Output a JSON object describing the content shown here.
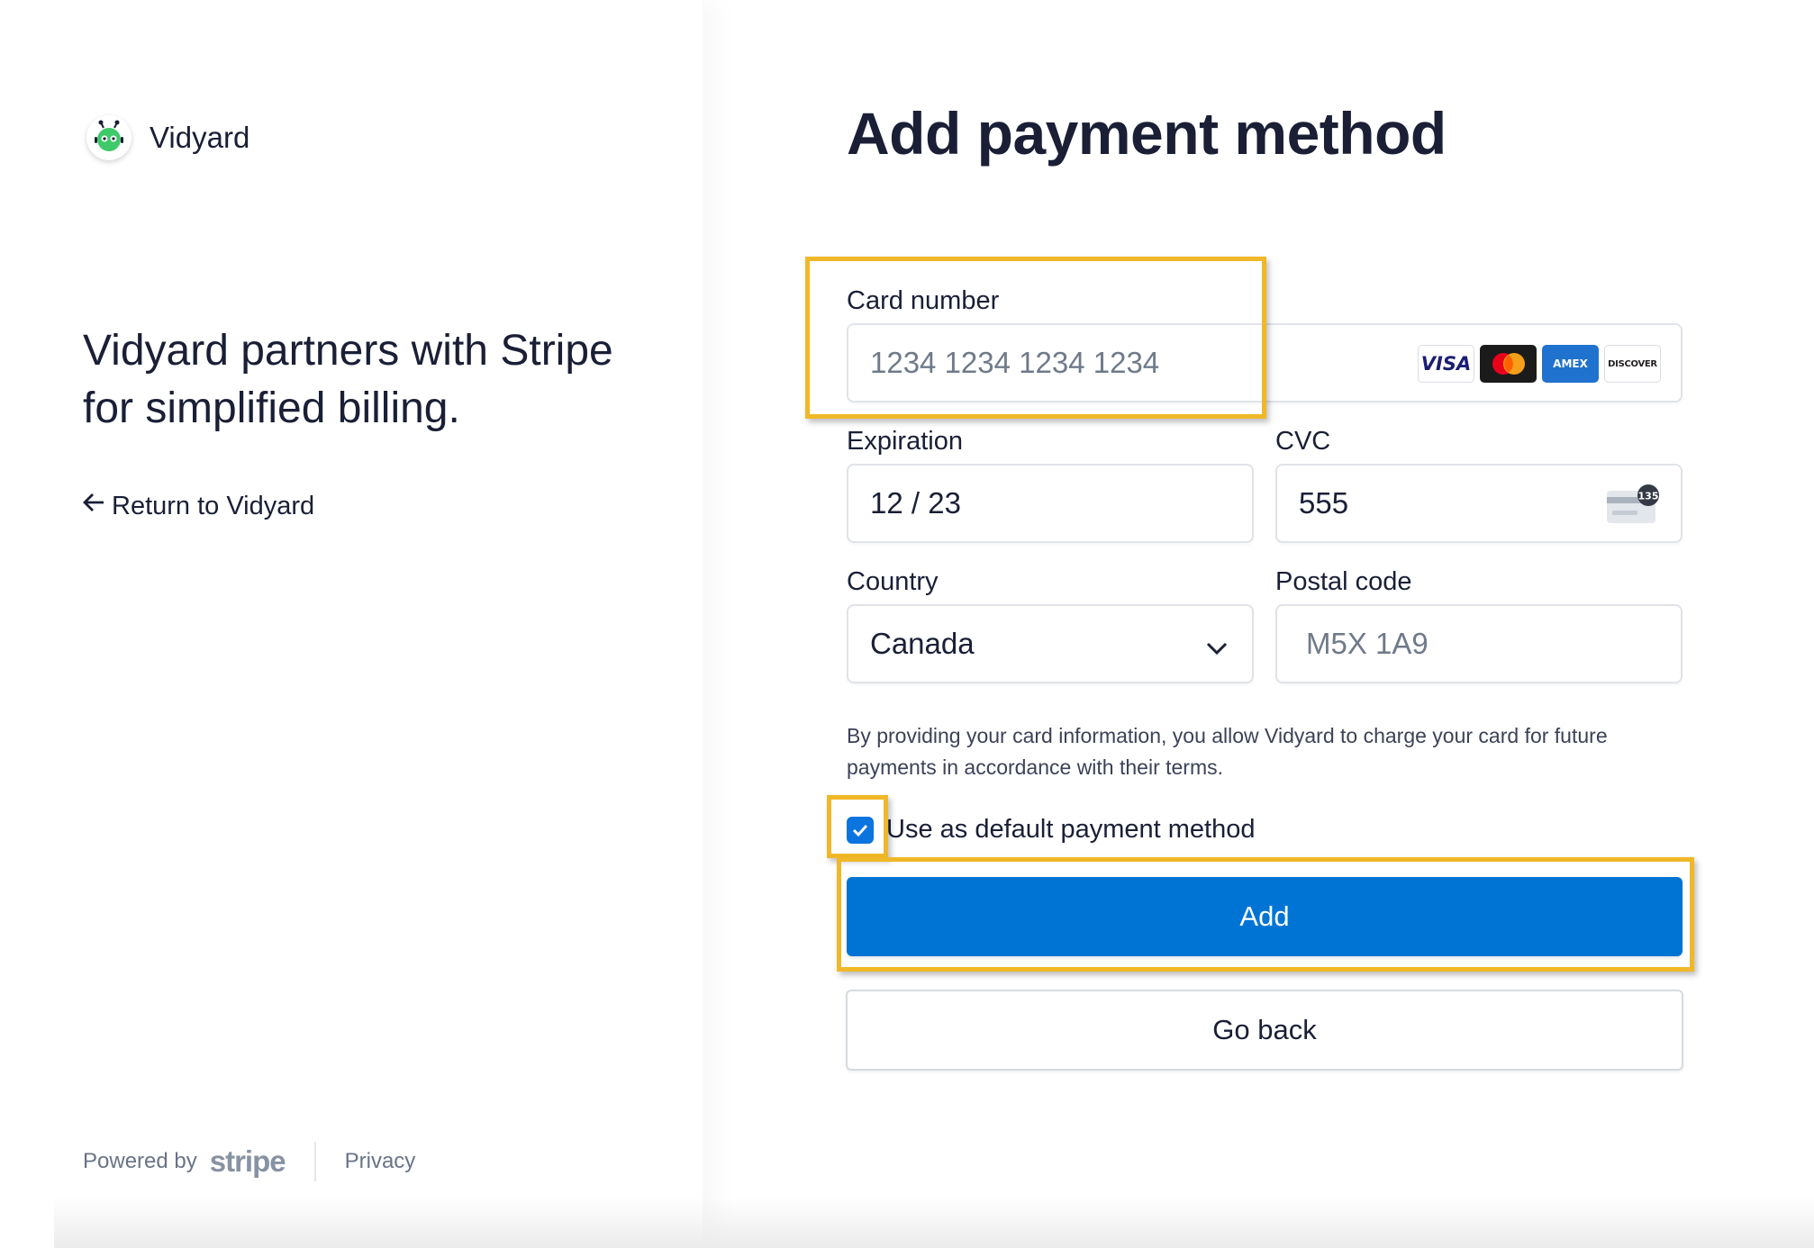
{
  "colors": {
    "accent": "#0074d4",
    "checkbox": "#0b74de",
    "highlight": "#f0b828",
    "text": "#1a1f36",
    "muted": "#697386"
  },
  "brand": {
    "name": "Vidyard",
    "logo_icon": "vidyard-robot-logo-icon"
  },
  "tagline": "Vidyard partners with Stripe for simplified billing.",
  "return_link": {
    "label": "Return to Vidyard",
    "icon": "arrow-left-icon"
  },
  "footer": {
    "powered_by": "Powered by",
    "stripe_logo": "stripe",
    "privacy": "Privacy"
  },
  "form": {
    "title": "Add payment method",
    "card_number": {
      "label": "Card number",
      "placeholder": "1234 1234 1234 1234",
      "brands": [
        "VISA",
        "Mastercard",
        "AMEX",
        "DISCOVER"
      ]
    },
    "expiration": {
      "label": "Expiration",
      "value": "12 / 23"
    },
    "cvc": {
      "label": "CVC",
      "value": "555",
      "icon_badge": "135",
      "icon": "card-cvc-icon"
    },
    "country": {
      "label": "Country",
      "value": "Canada",
      "icon": "chevron-down-icon"
    },
    "postal_code": {
      "label": "Postal code",
      "placeholder": "M5X 1A9"
    },
    "consent": "By providing your card information, you allow Vidyard to charge your card for future payments in accordance with their terms.",
    "default_checkbox": {
      "label": "Use as default payment method",
      "checked": true
    },
    "add_button": "Add",
    "back_button": "Go back"
  }
}
